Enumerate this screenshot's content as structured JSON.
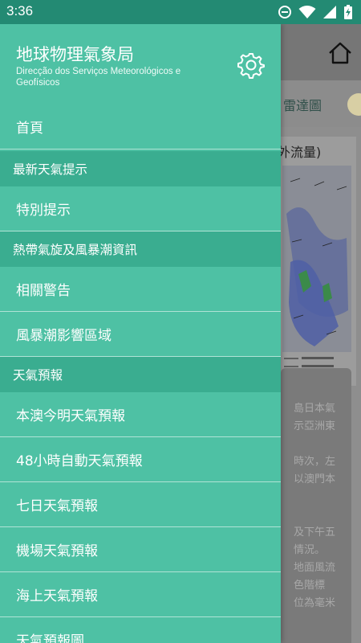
{
  "status_bar": {
    "time": "3:36",
    "icons": [
      "do-not-disturb-icon",
      "wifi-icon",
      "signal-icon",
      "battery-charging-icon"
    ]
  },
  "background_app": {
    "radar_tab": "雷達圖",
    "map_caption": "外流量)",
    "text_snippet": "島日本氣\n示亞洲東\n\n時次，左\n以澳門本\n\n\n及下午五\n情況。\n地面風流\n色階標\n位為毫米"
  },
  "drawer": {
    "title": "地球物理氣象局",
    "subtitle": "Direcção dos Serviços Meteorológicos e Geofísicos",
    "items": [
      {
        "type": "item",
        "label": "首頁"
      },
      {
        "type": "section",
        "label": "最新天氣提示"
      },
      {
        "type": "item",
        "label": "特別提示"
      },
      {
        "type": "section",
        "label": "熱帶氣旋及風暴潮資訊"
      },
      {
        "type": "item",
        "label": "相關警告"
      },
      {
        "type": "item",
        "label": "風暴潮影響區域"
      },
      {
        "type": "section",
        "label": "天氣預報"
      },
      {
        "type": "item",
        "label": "本澳今明天氣預報"
      },
      {
        "type": "item",
        "label": "48小時自動天氣預報"
      },
      {
        "type": "item",
        "label": "七日天氣預報"
      },
      {
        "type": "item",
        "label": "機場天氣預報"
      },
      {
        "type": "item",
        "label": "海上天氣預報"
      },
      {
        "type": "item",
        "label": "天氣預報圖"
      }
    ]
  },
  "colors": {
    "drawer_bg": "#4ec1a4",
    "section_bg": "#3aad90",
    "status_bar": "#238a73"
  }
}
